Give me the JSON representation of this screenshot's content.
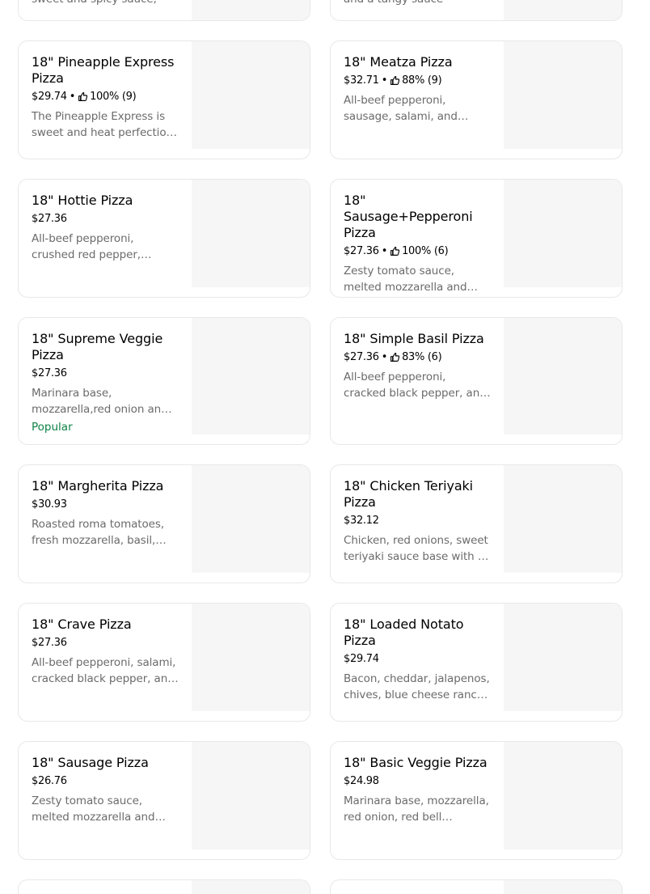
{
  "items": [
    {
      "name": "18\" Pineapple Express Pizza",
      "price": "$29.74",
      "rating": "100% (9)",
      "description": "The Pineapple Express is sweet and heat perfection. Made with",
      "badge": ""
    },
    {
      "name": "18\" Meatza Pizza",
      "price": "$32.71",
      "rating": "88% (9)",
      "description": "All-beef pepperoni, sausage, salami, and bacon.",
      "badge": ""
    },
    {
      "name": "18\" Hottie Pizza",
      "price": "$27.36",
      "rating": "",
      "description": "All-beef pepperoni, crushed red pepper, jalapeños, and more",
      "badge": ""
    },
    {
      "name": "18\" Sausage+Pepperoni Pizza",
      "price": "$27.36",
      "rating": "100% (6)",
      "description": "Zesty tomato sauce, melted mozzarella and topped with sausage",
      "badge": ""
    },
    {
      "name": "18\" Supreme Veggie Pizza",
      "price": "$27.36",
      "rating": "",
      "description": "Marinara base, mozzarella,red onion and more veggies",
      "badge": "Popular"
    },
    {
      "name": "18\" Simple Basil Pizza",
      "price": "$27.36",
      "rating": "83% (6)",
      "description": "All-beef pepperoni, cracked black pepper, and fresh basil",
      "badge": ""
    },
    {
      "name": "18\" Margherita Pizza",
      "price": "$30.93",
      "rating": "",
      "description": "Roasted roma tomatoes, fresh mozzarella, basil, and more",
      "badge": ""
    },
    {
      "name": "18\" Chicken Teriyaki Pizza",
      "price": "$32.12",
      "rating": "",
      "description": "Chicken, red onions, sweet teriyaki sauce base with a drizzle",
      "badge": ""
    },
    {
      "name": "18\" Crave Pizza",
      "price": "$27.36",
      "rating": "",
      "description": "All-beef pepperoni, salami, cracked black pepper, and more",
      "badge": ""
    },
    {
      "name": "18\" Loaded Notato Pizza",
      "price": "$29.74",
      "rating": "",
      "description": "Bacon, cheddar, jalapenos, chives, blue cheese ranch and more",
      "badge": ""
    },
    {
      "name": "18\" Sausage Pizza",
      "price": "$26.76",
      "rating": "",
      "description": "Zesty tomato sauce, melted mozzarella and topped with sausage",
      "badge": ""
    },
    {
      "name": "18\" Basic Veggie Pizza",
      "price": "$24.98",
      "rating": "",
      "description": "Marinara base, mozzarella, red onion, red bell peppers, and more",
      "badge": ""
    }
  ],
  "partial_top": {
    "left_text": "sweet and spicy sauce,",
    "right_text": "and a tangy sauce"
  },
  "colors": {
    "popular": "#0e8345",
    "description": "#6b6b6b",
    "thumbnail_bg": "#f6f6f6",
    "card_border": "#e8e8e8"
  },
  "icons": {
    "rating": "thumbs-up-icon"
  }
}
